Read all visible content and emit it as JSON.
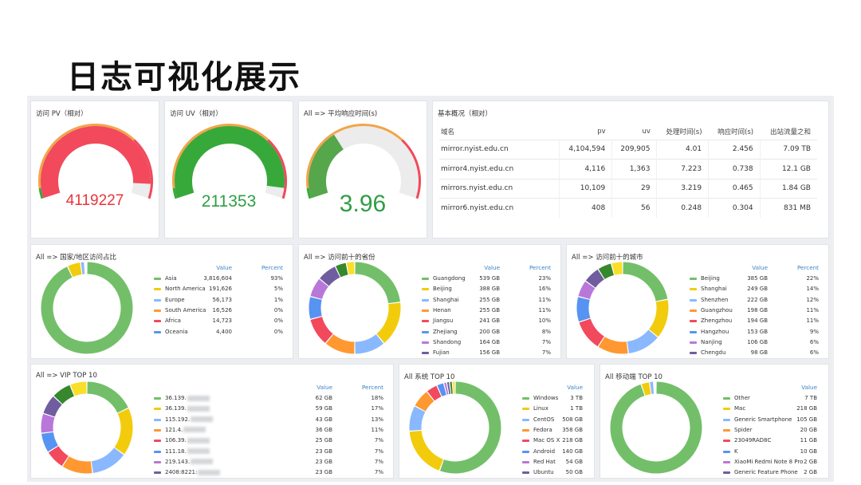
{
  "slide_title": "日志可视化展示",
  "gauges": [
    {
      "title": "访问 PV（相对）",
      "value": "4119227",
      "level": 0.93,
      "value_color": "#e8353a",
      "arc_color": "#f2495c"
    },
    {
      "title": "访问 UV（相对）",
      "value": "211353",
      "level": 0.95,
      "value_color": "#2f9e44",
      "arc_color": "#37a93a"
    },
    {
      "title": "All => 平均响应时间(s)",
      "value": "3.96",
      "level": 0.35,
      "value_color": "#2f9e44",
      "arc_color": "#56a64b"
    }
  ],
  "basic": {
    "title": "基本概况（相对）",
    "headers": [
      "域名",
      "pv",
      "uv",
      "处理时间(s)",
      "响应时间(s)",
      "出站流量之和"
    ],
    "rows": [
      [
        "mirror.nyist.edu.cn",
        "4,104,594",
        "209,905",
        "4.01",
        "2.456",
        "7.09 TB"
      ],
      [
        "mirror4.nyist.edu.cn",
        "4,116",
        "1,363",
        "7.223",
        "0.738",
        "12.1 GB"
      ],
      [
        "mirrors.nyist.edu.cn",
        "10,109",
        "29",
        "3.219",
        "0.465",
        "1.84 GB"
      ],
      [
        "mirror6.nyist.edu.cn",
        "408",
        "56",
        "0.248",
        "0.304",
        "831 MB"
      ]
    ]
  },
  "legend_header": {
    "value": "Value",
    "percent": "Percent"
  },
  "donuts": [
    {
      "title": "All => 国家/地区访问占比",
      "items": [
        {
          "name": "Asia",
          "value": "3,816,604",
          "percent": "93%",
          "color": "#73bf69",
          "frac": 0.93
        },
        {
          "name": "North America",
          "value": "191,626",
          "percent": "5%",
          "color": "#f2cc0c",
          "frac": 0.047
        },
        {
          "name": "Europe",
          "value": "56,173",
          "percent": "1%",
          "color": "#8ab8ff",
          "frac": 0.014
        },
        {
          "name": "South America",
          "value": "16,526",
          "percent": "0%",
          "color": "#ff9830",
          "frac": 0.004
        },
        {
          "name": "Africa",
          "value": "14,723",
          "percent": "0%",
          "color": "#f2495c",
          "frac": 0.0036
        },
        {
          "name": "Oceania",
          "value": "4,400",
          "percent": "0%",
          "color": "#5794f2",
          "frac": 0.0011
        }
      ]
    },
    {
      "title": "All => 访问前十的省份",
      "items": [
        {
          "name": "Guangdong",
          "value": "539 GB",
          "percent": "23%",
          "color": "#73bf69",
          "frac": 0.23
        },
        {
          "name": "Beijing",
          "value": "388 GB",
          "percent": "16%",
          "color": "#f2cc0c",
          "frac": 0.16
        },
        {
          "name": "Shanghai",
          "value": "255 GB",
          "percent": "11%",
          "color": "#8ab8ff",
          "frac": 0.11
        },
        {
          "name": "Henan",
          "value": "255 GB",
          "percent": "11%",
          "color": "#ff9830",
          "frac": 0.11
        },
        {
          "name": "Jiangsu",
          "value": "241 GB",
          "percent": "10%",
          "color": "#f2495c",
          "frac": 0.1
        },
        {
          "name": "Zhejiang",
          "value": "200 GB",
          "percent": "8%",
          "color": "#5794f2",
          "frac": 0.08
        },
        {
          "name": "Shandong",
          "value": "164 GB",
          "percent": "7%",
          "color": "#b877d9",
          "frac": 0.07
        },
        {
          "name": "Fujian",
          "value": "156 GB",
          "percent": "7%",
          "color": "#705da0",
          "frac": 0.07
        },
        {
          "name": "",
          "value": "",
          "percent": "",
          "color": "#37872d",
          "frac": 0.04
        },
        {
          "name": "",
          "value": "",
          "percent": "",
          "color": "#fade2a",
          "frac": 0.03
        }
      ]
    },
    {
      "title": "All => 访问前十的城市",
      "items": [
        {
          "name": "Beijing",
          "value": "385 GB",
          "percent": "22%",
          "color": "#73bf69",
          "frac": 0.22
        },
        {
          "name": "Shanghai",
          "value": "249 GB",
          "percent": "14%",
          "color": "#f2cc0c",
          "frac": 0.14
        },
        {
          "name": "Shenzhen",
          "value": "222 GB",
          "percent": "12%",
          "color": "#8ab8ff",
          "frac": 0.12
        },
        {
          "name": "Guangzhou",
          "value": "198 GB",
          "percent": "11%",
          "color": "#ff9830",
          "frac": 0.11
        },
        {
          "name": "Zhengzhou",
          "value": "194 GB",
          "percent": "11%",
          "color": "#f2495c",
          "frac": 0.11
        },
        {
          "name": "Hangzhou",
          "value": "153 GB",
          "percent": "9%",
          "color": "#5794f2",
          "frac": 0.09
        },
        {
          "name": "Nanjing",
          "value": "106 GB",
          "percent": "6%",
          "color": "#b877d9",
          "frac": 0.06
        },
        {
          "name": "Chengdu",
          "value": "98 GB",
          "percent": "6%",
          "color": "#705da0",
          "frac": 0.06
        },
        {
          "name": "",
          "value": "",
          "percent": "",
          "color": "#37872d",
          "frac": 0.05
        },
        {
          "name": "",
          "value": "",
          "percent": "",
          "color": "#fade2a",
          "frac": 0.04
        }
      ]
    },
    {
      "title": "All => VIP TOP 10",
      "items": [
        {
          "name": "36.139.",
          "value": "62 GB",
          "percent": "18%",
          "color": "#73bf69",
          "frac": 0.18,
          "masked": true
        },
        {
          "name": "36.139.",
          "value": "59 GB",
          "percent": "17%",
          "color": "#f2cc0c",
          "frac": 0.17,
          "masked": true
        },
        {
          "name": "115.192.",
          "value": "43 GB",
          "percent": "13%",
          "color": "#8ab8ff",
          "frac": 0.13,
          "masked": true
        },
        {
          "name": "121.4.",
          "value": "36 GB",
          "percent": "11%",
          "color": "#ff9830",
          "frac": 0.11,
          "masked": true
        },
        {
          "name": "106.39.",
          "value": "25 GB",
          "percent": "7%",
          "color": "#f2495c",
          "frac": 0.07,
          "masked": true
        },
        {
          "name": "111.18.",
          "value": "23 GB",
          "percent": "7%",
          "color": "#5794f2",
          "frac": 0.07,
          "masked": true
        },
        {
          "name": "219.143.",
          "value": "23 GB",
          "percent": "7%",
          "color": "#b877d9",
          "frac": 0.07,
          "masked": true
        },
        {
          "name": "2408:8221:",
          "value": "23 GB",
          "percent": "7%",
          "color": "#705da0",
          "frac": 0.07,
          "masked": true
        },
        {
          "name": "",
          "value": "",
          "percent": "",
          "color": "#37872d",
          "frac": 0.07
        },
        {
          "name": "",
          "value": "",
          "percent": "",
          "color": "#fade2a",
          "frac": 0.06
        }
      ]
    },
    {
      "title": "All 系统 TOP 10",
      "items": [
        {
          "name": "Windows",
          "value": "3 TB",
          "percent": "",
          "color": "#73bf69",
          "frac": 0.55
        },
        {
          "name": "Linux",
          "value": "1 TB",
          "percent": "",
          "color": "#f2cc0c",
          "frac": 0.18
        },
        {
          "name": "CentOS",
          "value": "508 GB",
          "percent": "",
          "color": "#8ab8ff",
          "frac": 0.09
        },
        {
          "name": "Fedora",
          "value": "358 GB",
          "percent": "",
          "color": "#ff9830",
          "frac": 0.065
        },
        {
          "name": "Mac OS X",
          "value": "218 GB",
          "percent": "",
          "color": "#f2495c",
          "frac": 0.04
        },
        {
          "name": "Android",
          "value": "140 GB",
          "percent": "",
          "color": "#5794f2",
          "frac": 0.025
        },
        {
          "name": "Red Hat",
          "value": "54 GB",
          "percent": "",
          "color": "#b877d9",
          "frac": 0.01
        },
        {
          "name": "Ubuntu",
          "value": "50 GB",
          "percent": "",
          "color": "#705da0",
          "frac": 0.01
        },
        {
          "name": "",
          "value": "",
          "percent": "",
          "color": "#37872d",
          "frac": 0.01
        },
        {
          "name": "",
          "value": "",
          "percent": "",
          "color": "#fade2a",
          "frac": 0.01
        }
      ]
    },
    {
      "title": "All 移动端 TOP 10",
      "items": [
        {
          "name": "Other",
          "value": "7 TB",
          "percent": "",
          "color": "#73bf69",
          "frac": 0.94
        },
        {
          "name": "Mac",
          "value": "218 GB",
          "percent": "",
          "color": "#f2cc0c",
          "frac": 0.03
        },
        {
          "name": "Generic Smartphone",
          "value": "105 GB",
          "percent": "",
          "color": "#8ab8ff",
          "frac": 0.014
        },
        {
          "name": "Spider",
          "value": "20 GB",
          "percent": "",
          "color": "#ff9830",
          "frac": 0.003
        },
        {
          "name": "23049RAD8C",
          "value": "11 GB",
          "percent": "",
          "color": "#f2495c",
          "frac": 0.002
        },
        {
          "name": "K",
          "value": "10 GB",
          "percent": "",
          "color": "#5794f2",
          "frac": 0.002
        },
        {
          "name": "XiaoMi Redmi Note 8 Pro",
          "value": "2 GB",
          "percent": "",
          "color": "#b877d9",
          "frac": 0.001
        },
        {
          "name": "Generic Feature Phone",
          "value": "2 GB",
          "percent": "",
          "color": "#705da0",
          "frac": 0.001
        }
      ]
    }
  ]
}
